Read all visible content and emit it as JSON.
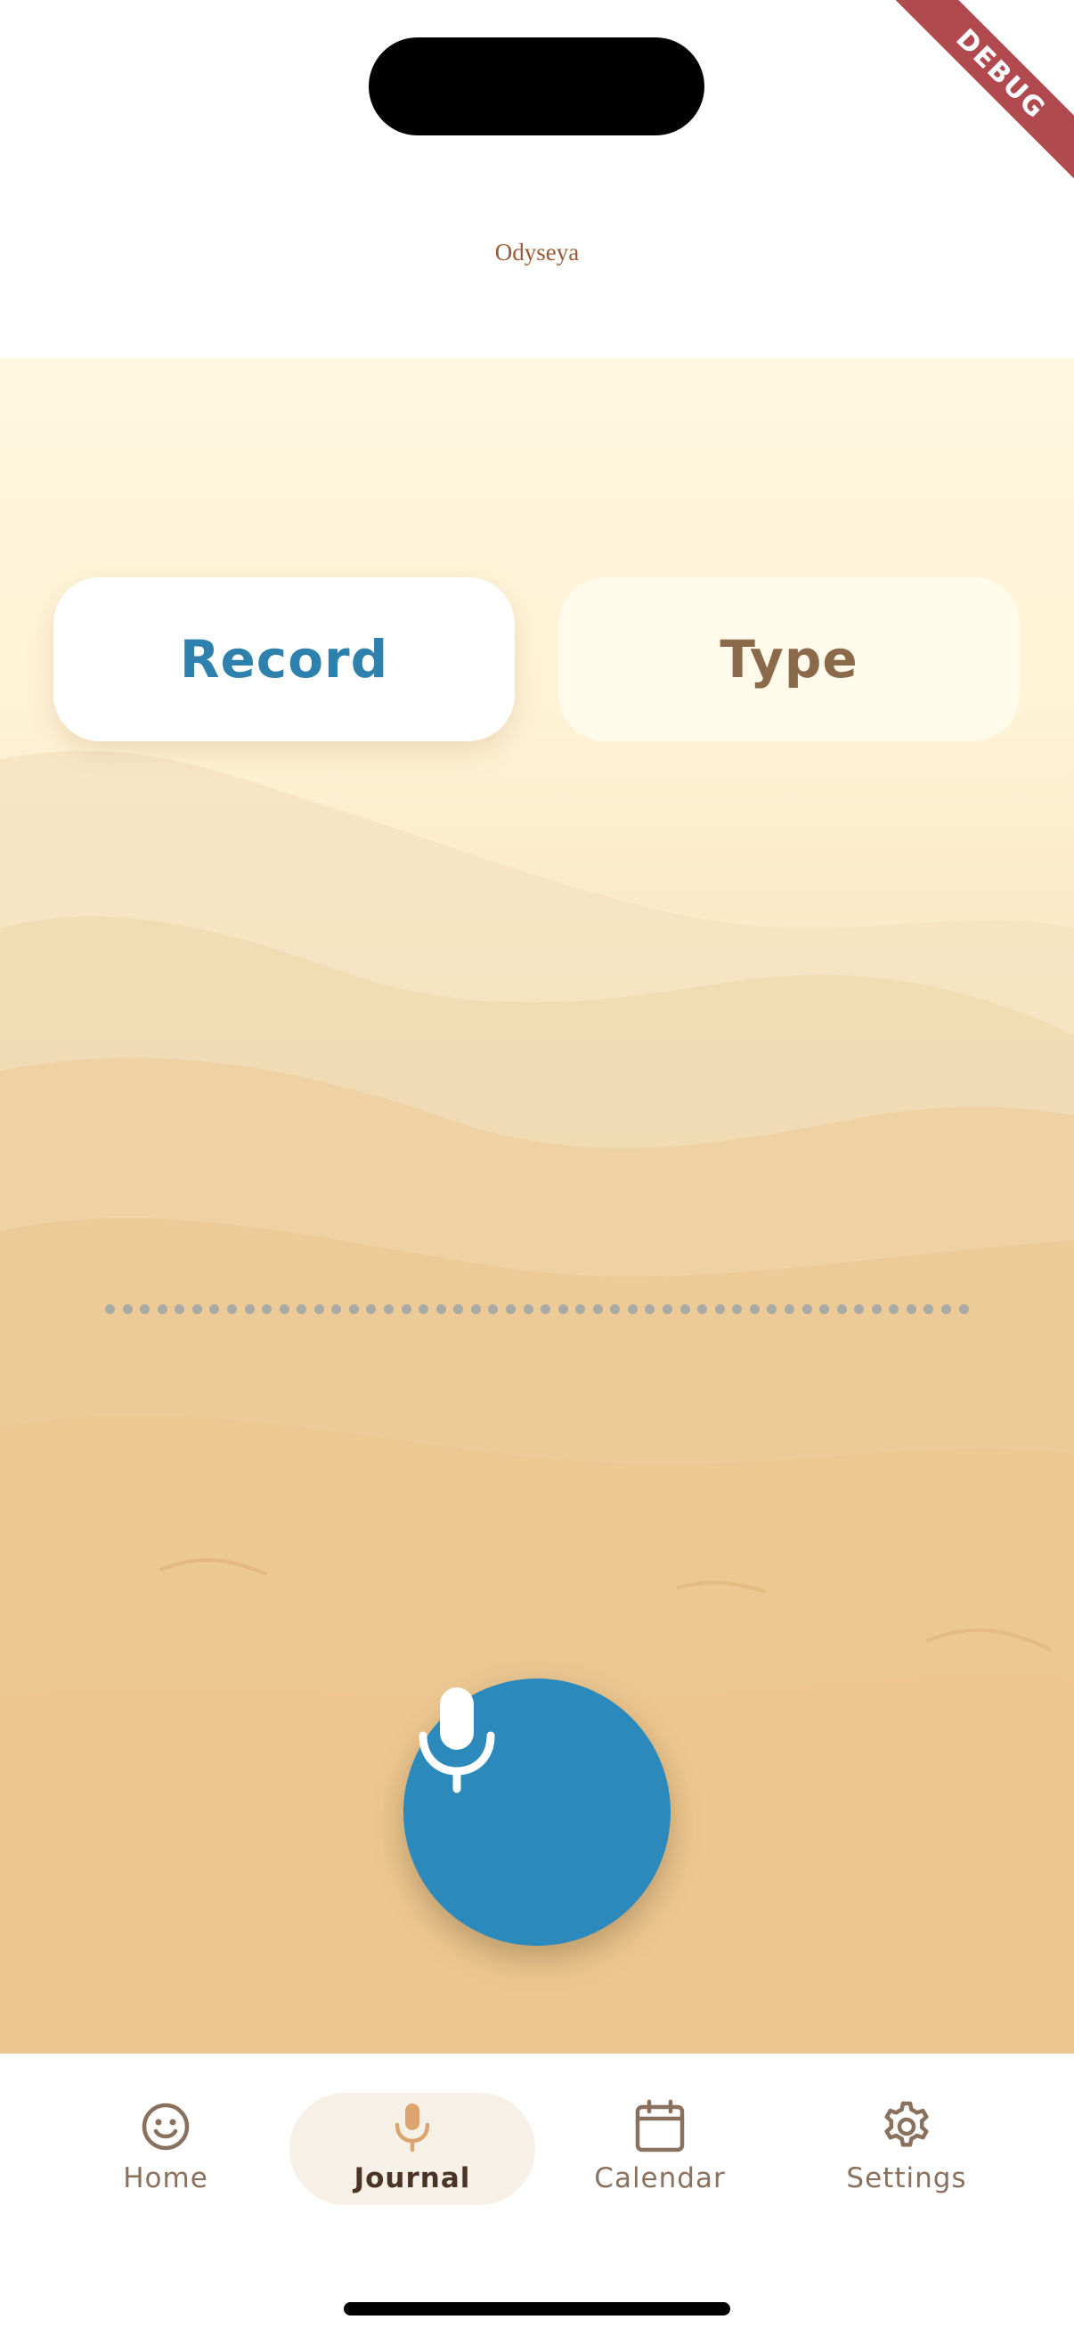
{
  "status": {
    "debug_banner": "DEBUG"
  },
  "header": {
    "app_title": "Odyseya"
  },
  "mode_toggle": {
    "options": [
      {
        "label": "Record",
        "selected": true
      },
      {
        "label": "Type",
        "selected": false
      }
    ]
  },
  "recorder": {
    "mic_button_icon": "microphone-icon",
    "waveform_dot_count": 50,
    "accent_color": "#2b8abb"
  },
  "bottom_nav": {
    "items": [
      {
        "label": "Home",
        "icon": "smiley-icon",
        "active": false
      },
      {
        "label": "Journal",
        "icon": "microphone-icon",
        "active": true
      },
      {
        "label": "Calendar",
        "icon": "calendar-icon",
        "active": false
      },
      {
        "label": "Settings",
        "icon": "gear-icon",
        "active": false
      }
    ]
  }
}
